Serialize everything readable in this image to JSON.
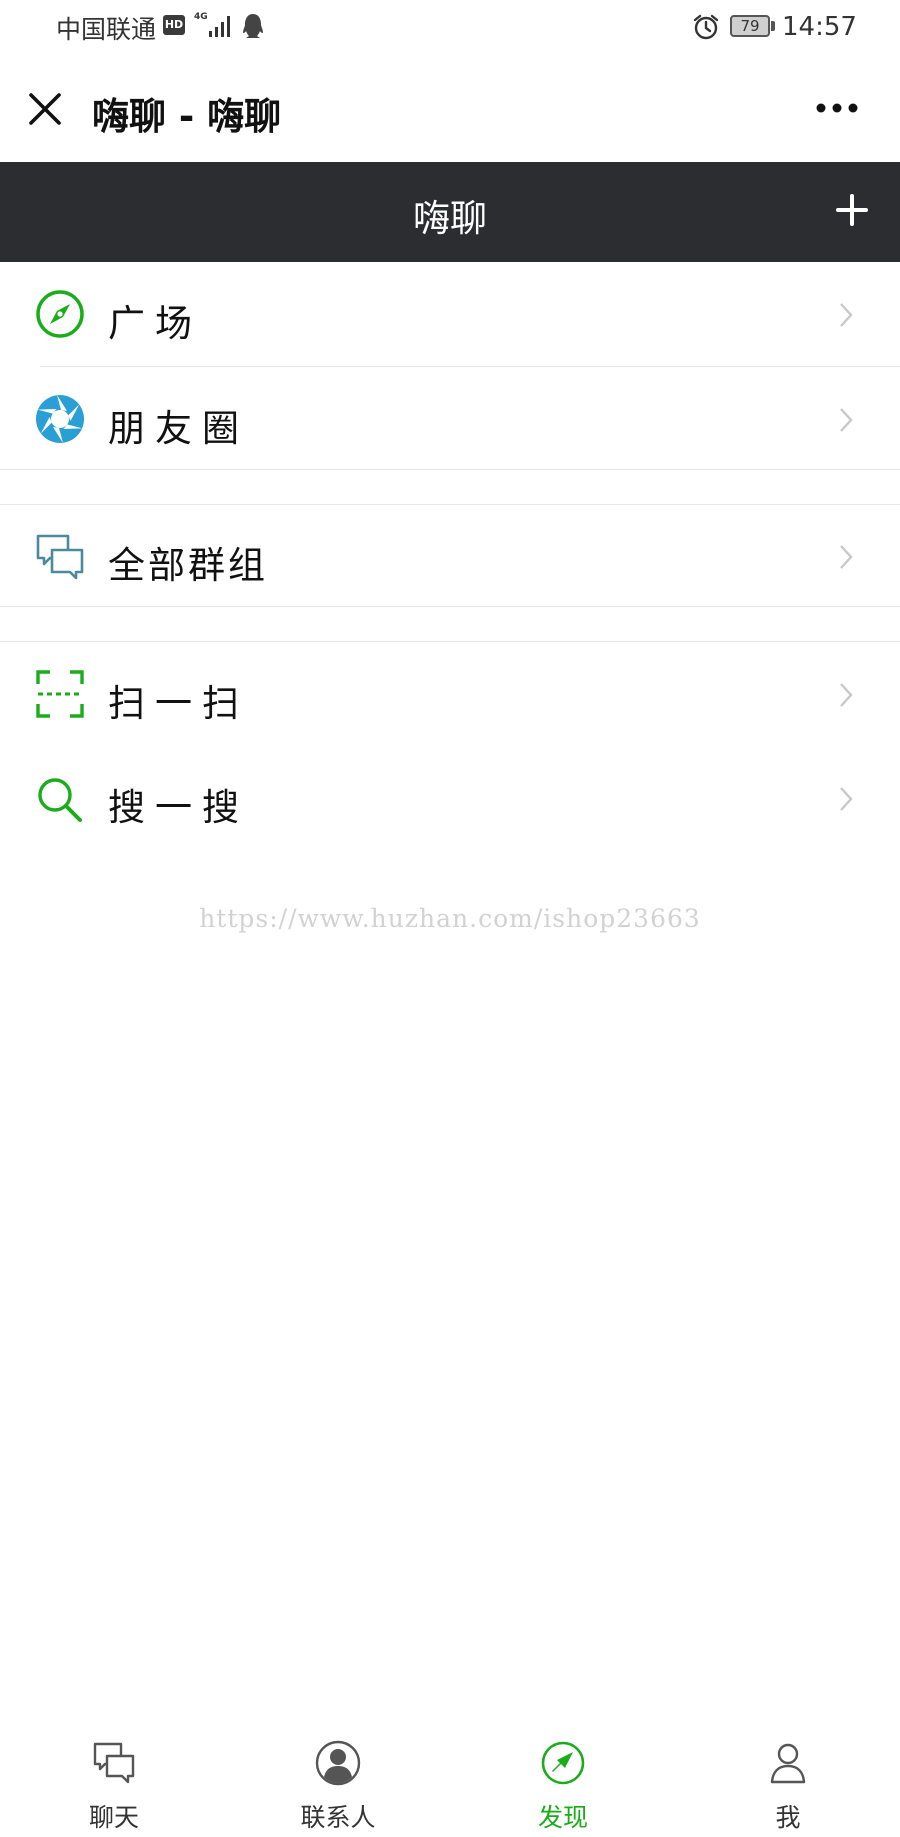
{
  "status_bar": {
    "carrier": "中国联通",
    "hd_badge": "HD",
    "network": "4G",
    "battery": "79",
    "time": "14:57"
  },
  "header": {
    "title": "嗨聊 - 嗨聊"
  },
  "titlebar": {
    "title": "嗨聊"
  },
  "menu": {
    "items": [
      {
        "label": "广场",
        "icon": "compass-icon"
      },
      {
        "label": "朋友圈",
        "icon": "shutter-icon"
      },
      {
        "label": "全部群组",
        "icon": "chat-bubbles-icon"
      },
      {
        "label": "扫一扫",
        "icon": "scan-icon"
      },
      {
        "label": "搜一搜",
        "icon": "search-icon"
      }
    ]
  },
  "watermark": "https://www.huzhan.com/ishop23663",
  "tabs": [
    {
      "label": "聊天",
      "icon": "chat-icon"
    },
    {
      "label": "联系人",
      "icon": "contacts-icon"
    },
    {
      "label": "发现",
      "icon": "discover-icon",
      "active": true
    },
    {
      "label": "我",
      "icon": "profile-icon"
    }
  ],
  "colors": {
    "accent": "#1aad19",
    "titlebar_bg": "#2c2d31",
    "shutter": "#2a9fd6"
  }
}
